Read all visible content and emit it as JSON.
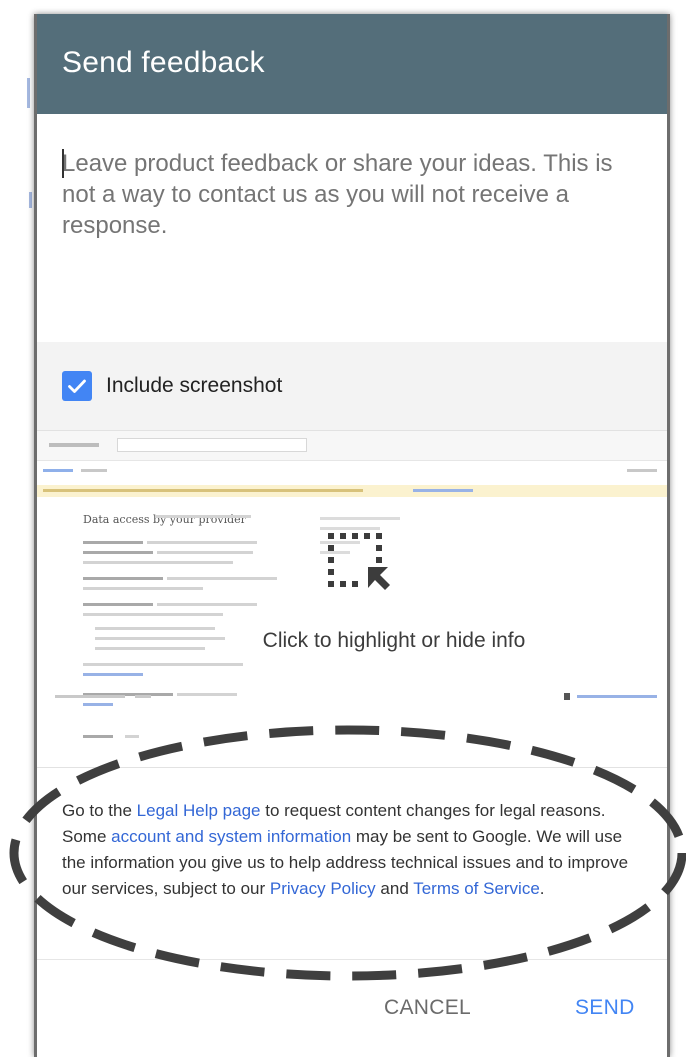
{
  "dialog": {
    "title": "Send feedback",
    "feedback_placeholder": "Leave product feedback or share your ideas. This is not a way to contact us as you will not receive a response.",
    "include_screenshot_label": "Include screenshot",
    "include_screenshot_checked": true,
    "preview": {
      "highlight_text": "Click to highlight or hide info",
      "mini_heading_text": "Data access by your provider"
    },
    "legal": {
      "t1": "Go to the ",
      "legal_help_link": "Legal Help page",
      "t2": " to request content changes for legal reasons. Some ",
      "account_info_link": "account and system information",
      "t3": " may be sent to Google. We will use the information you give us to help address technical issues and to improve our services, subject to our ",
      "privacy_link": "Privacy Policy",
      "t4": " and ",
      "terms_link": "Terms of Service",
      "t5": "."
    },
    "cancel_label": "CANCEL",
    "send_label": "SEND"
  },
  "colors": {
    "header": "#546e7a",
    "accent": "#4285f4",
    "link": "#3367d6",
    "annotation_dash": "#3f3f3f"
  },
  "icons": {
    "checkbox": "check-icon",
    "highlight": "highlight-selection-icon"
  }
}
